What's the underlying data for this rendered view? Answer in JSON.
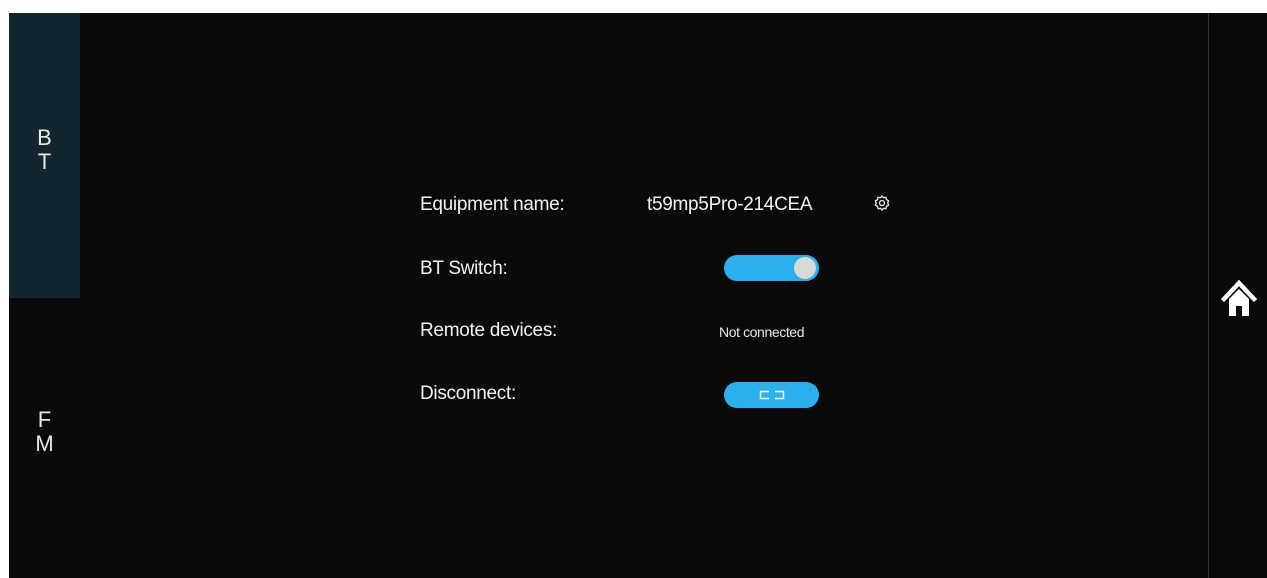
{
  "sidebar": {
    "tabs": [
      {
        "label_top": "B",
        "label_bottom": "T",
        "active": true
      },
      {
        "label_top": "F",
        "label_bottom": "M",
        "active": false
      }
    ]
  },
  "bluetooth": {
    "equipment_name_label": "Equipment name:",
    "equipment_name_value": "t59mp5Pro-214CEA",
    "switch_label": "BT Switch:",
    "switch_on": true,
    "remote_label": "Remote devices:",
    "remote_status": "Not connected",
    "disconnect_label": "Disconnect:"
  },
  "icons": {
    "settings": "gear-icon",
    "home": "home-icon",
    "disconnect": "unlink-icon"
  },
  "colors": {
    "background": "#0a0a0a",
    "active_tab": "#13262f",
    "accent": "#2bb0ee",
    "text": "#f2f2f2"
  }
}
